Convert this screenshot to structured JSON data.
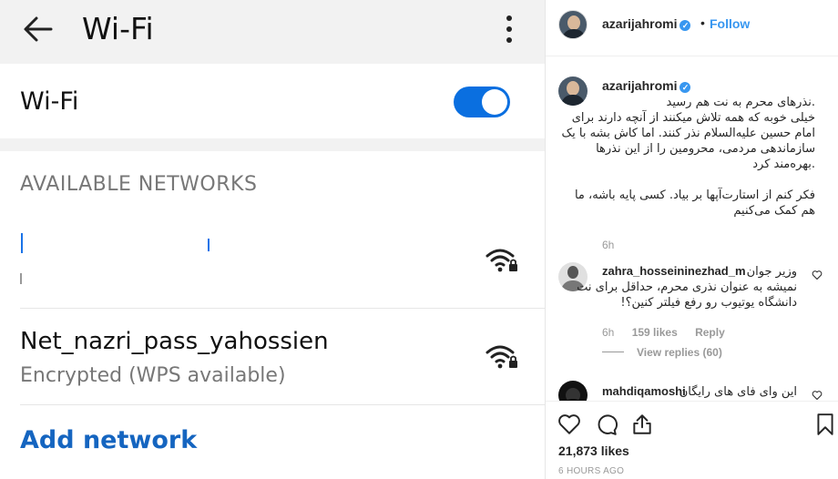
{
  "phone": {
    "title": "Wi-Fi",
    "wifi_label": "Wi-Fi",
    "wifi_enabled": true,
    "section_header": "AVAILABLE NETWORKS",
    "networks": [
      {
        "name": "",
        "status": "",
        "redacted": true,
        "secured": true
      },
      {
        "name": "Net_nazri_pass_yahossien",
        "status": "Encrypted (WPS available)",
        "secured": true
      }
    ],
    "add_network": "Add network",
    "accent_color": "#0a6fe0"
  },
  "instagram": {
    "header": {
      "username": "azarijahromi",
      "follow_label": "Follow",
      "separator": "•"
    },
    "caption": {
      "username": "azarijahromi",
      "lines": [
        ".نذرهای محرم به نت هم رسید",
        "خیلی خوبه که همه تلاش میکنند از آنچه دارند برای",
        "امام حسین علیه‌السلام نذر کنند. اما کاش بشه با یک",
        "سازماندهی مردمی، محرومین را از این نذرها",
        ".بهره‌مند کرد",
        "",
        "فکر کنم از استارت‌آپها بر بیاد. کسی پایه باشه، ما",
        "هم کمک می‌کنیم"
      ],
      "time": "6h"
    },
    "comments": [
      {
        "username": "zahra_hosseininezhad_m",
        "lines": [
          "وزیر جوان",
          "نمیشه به عنوان نذری محرم، حداقل برای نت",
          "دانشگاه یوتیوب رو رفع فیلتر کنین؟!"
        ],
        "time": "6h",
        "likes": "159 likes",
        "reply": "Reply",
        "view_replies": "View replies (60)"
      },
      {
        "username": "mahdiqamoshi",
        "lines": [
          "این وای فای های رایگان"
        ]
      }
    ],
    "likes": "21,873 likes",
    "posted": "6 HOURS AGO",
    "link_color": "#3897f0"
  }
}
